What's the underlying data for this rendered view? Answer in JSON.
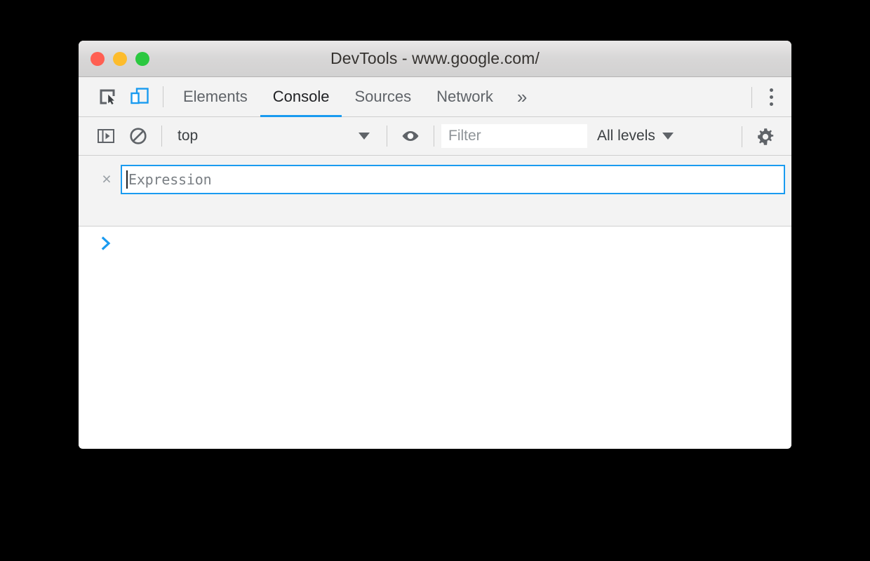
{
  "window": {
    "title": "DevTools - www.google.com/",
    "traffic_lights": [
      {
        "name": "close",
        "color": "#ff5f52"
      },
      {
        "name": "minimize",
        "color": "#fdbc2c"
      },
      {
        "name": "maximize",
        "color": "#2bc840"
      }
    ]
  },
  "toolbar_icons": {
    "inspect": "inspect-element-icon",
    "device": "device-toolbar-icon",
    "more": "more-options-icon"
  },
  "tabs": [
    {
      "label": "Elements",
      "active": false
    },
    {
      "label": "Console",
      "active": true
    },
    {
      "label": "Sources",
      "active": false
    },
    {
      "label": "Network",
      "active": false
    }
  ],
  "tab_overflow": "»",
  "console_toolbar": {
    "sidebar_toggle_icon": "console-sidebar-icon",
    "clear_icon": "clear-console-icon",
    "context": "top",
    "eye_icon": "create-live-expression-icon",
    "filter_placeholder": "Filter",
    "filter_value": "",
    "levels": "All levels",
    "settings_icon": "settings-gear-icon"
  },
  "live_expression": {
    "close_glyph": "×",
    "placeholder": "Expression",
    "value": ""
  },
  "console_body": {
    "prompt_glyph": ">",
    "prompt_color": "#1a9bf0",
    "entries": []
  },
  "colors": {
    "accent": "#1a9bf0",
    "toolbar_bg": "#f3f3f3",
    "titlebar_bg": "#d8d7d7",
    "body_bg": "#ffffff",
    "text": "#3c4043",
    "muted_text": "#5f6368"
  }
}
